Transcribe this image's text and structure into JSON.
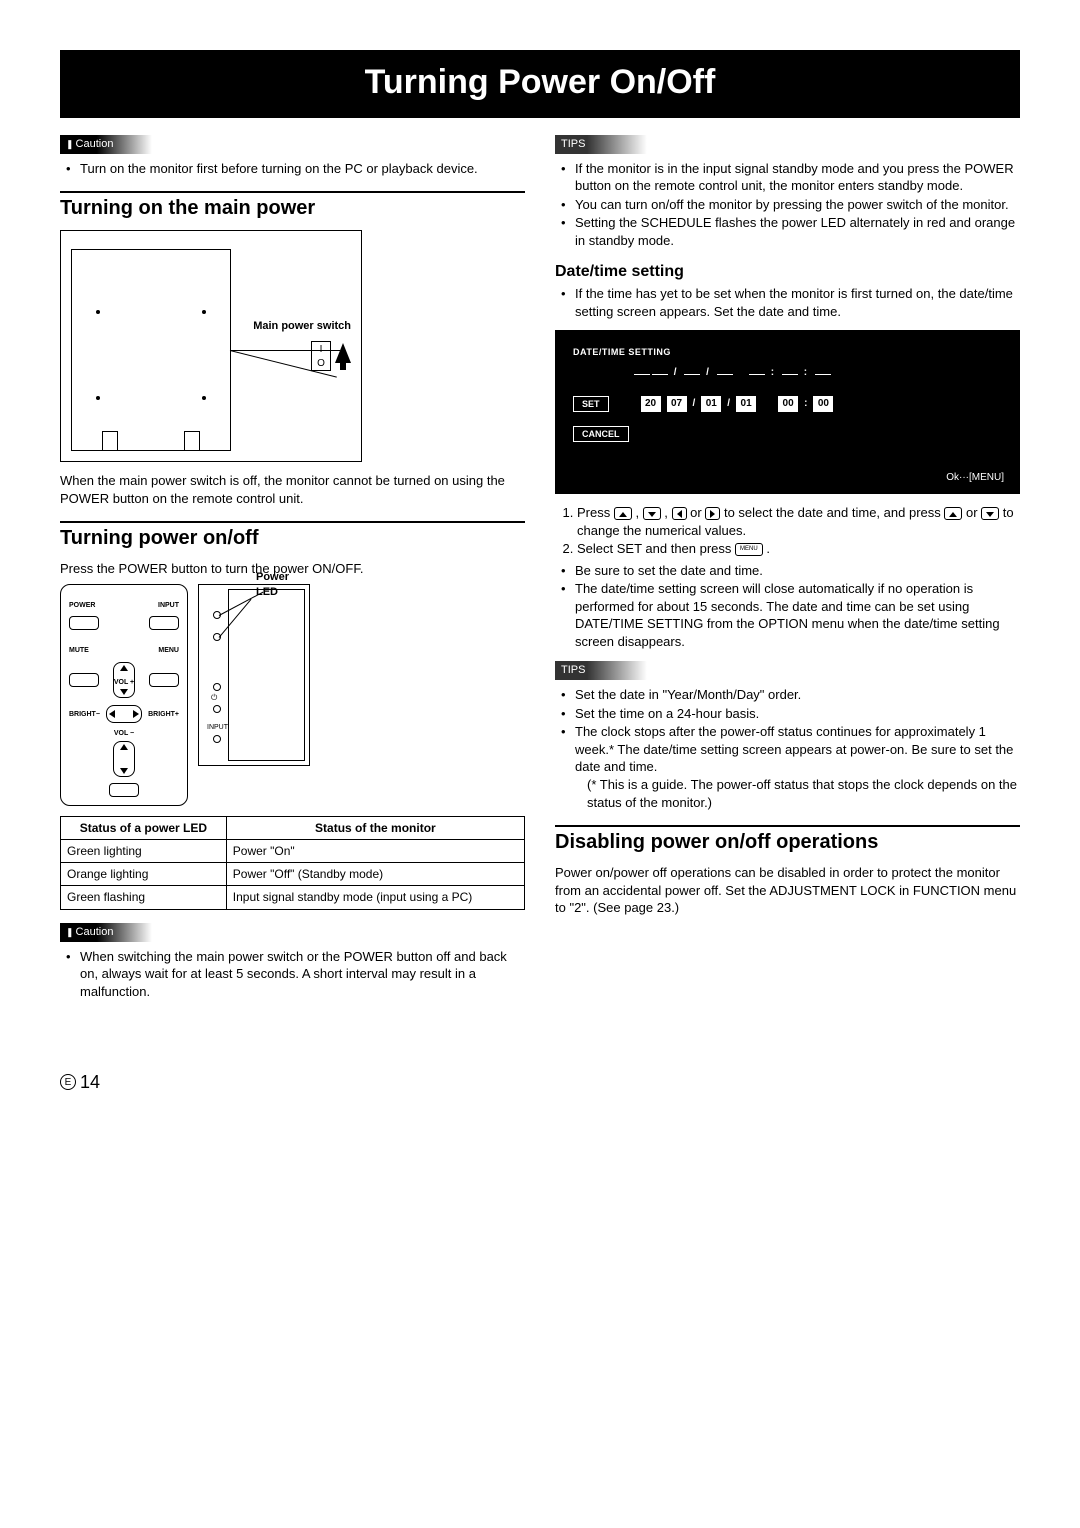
{
  "page": {
    "title": "Turning Power On/Off",
    "number": "14",
    "lang_marker": "E"
  },
  "left": {
    "caution1_label": "Caution",
    "caution1_items": [
      "Turn on the monitor first before turning on the PC or playback device."
    ],
    "h2a": "Turning on the main power",
    "main_switch_label": "Main power switch",
    "fig_note": "When the main power switch is off, the monitor cannot be turned on using the POWER button on the remote control unit.",
    "h2b": "Turning power on/off",
    "press_text": "Press the POWER button to turn the power ON/OFF.",
    "power_led_label": "Power LED",
    "remote_labels": {
      "power": "POWER",
      "input": "INPUT",
      "mute": "MUTE",
      "menu": "MENU",
      "vol_plus": "VOL +",
      "vol_minus": "VOL −",
      "bright_minus": "BRIGHT−",
      "bright_plus": "BRIGHT+",
      "input2": "INPUT"
    },
    "table": {
      "h1": "Status of a power LED",
      "h2": "Status of the monitor",
      "rows": [
        {
          "a": "Green lighting",
          "b": "Power \"On\""
        },
        {
          "a": "Orange lighting",
          "b": "Power \"Off\" (Standby mode)"
        },
        {
          "a": "Green flashing",
          "b": "Input signal standby mode (input using a PC)"
        }
      ]
    },
    "caution2_label": "Caution",
    "caution2_items": [
      "When switching the main power switch or the POWER button off and back on, always wait for at least 5 seconds. A short interval may result in a malfunction."
    ]
  },
  "right": {
    "tips1_label": "TIPS",
    "tips1_items": [
      "If the monitor is in the input signal standby mode and you press the POWER button on the remote control unit, the monitor enters standby mode.",
      "You can turn on/off the monitor by pressing the power switch of the monitor.",
      "Setting the SCHEDULE flashes the power LED alternately in red and orange in standby mode."
    ],
    "h3_dt": "Date/time setting",
    "dt_intro": "If the time has yet to be set when the monitor is first turned on, the date/time setting screen appears. Set the date and time.",
    "dt_screen": {
      "title": "DATE/TIME SETTING",
      "set": "SET",
      "cancel": "CANCEL",
      "ok": "Ok···[MENU]",
      "vals": {
        "c": "20",
        "y": "07",
        "m": "01",
        "d": "01",
        "h": "00",
        "mi": "00"
      }
    },
    "steps": [
      "Press  ,  ,  or  to select the date and time, and press  or  to change the numerical values.",
      "Select SET and then press  ."
    ],
    "step1_text_a": "Press ",
    "step1_text_b": " to select the date and time, and press ",
    "step1_text_c": " to change the numerical values.",
    "step2_text_a": "Select SET and then press ",
    "step2_text_b": " .",
    "menu_key": "MENU",
    "post_steps": [
      "Be sure to set the date and time.",
      "The date/time setting screen will close automatically if no operation is performed for about 15 seconds. The date and time can be set using DATE/TIME SETTING from the OPTION menu when the date/time setting screen disappears."
    ],
    "tips2_label": "TIPS",
    "tips2_items": [
      "Set the date in \"Year/Month/Day\" order.",
      "Set the time on a 24-hour basis.",
      "The clock stops after the power-off status continues for approximately 1 week.* The date/time setting screen appears at power-on. Be sure to set the date and time."
    ],
    "tips2_note": "(* This is a guide. The power-off status that stops the clock depends on the status of the monitor.)",
    "h2_disable": "Disabling power on/off operations",
    "disable_text": "Power on/power off operations can be disabled in order to protect the monitor from an accidental power off. Set the ADJUSTMENT LOCK in FUNCTION menu to \"2\". (See page 23.)"
  }
}
